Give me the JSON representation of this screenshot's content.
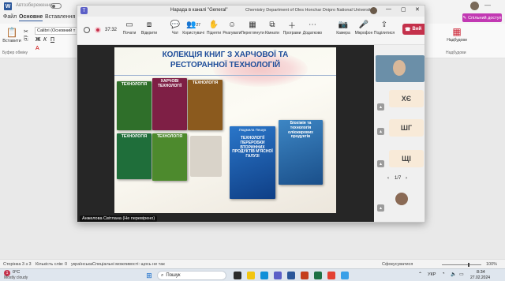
{
  "word": {
    "autosave_label": "Автозбереження",
    "tabs": [
      "Файл",
      "Основне",
      "Вставлення"
    ],
    "font_name": "Calibri (Основний т",
    "ribbon": {
      "paste_label": "Вставити",
      "clipboard_label": "Буфер обміну",
      "addins_label": "Надбудови",
      "addins_group_label": "Надбудови",
      "share_label": "Спільний доступ",
      "editor_hint": "Б"
    },
    "status": {
      "page": "Сторінка 3 з 3",
      "words": "Кількість слів: 0",
      "language": "українська",
      "accessibility": "Спеціальні можливості: щось не так",
      "focus": "Сфокусуватися",
      "zoom": "100%"
    }
  },
  "teams": {
    "title": "Нарада в каналі \"General\"",
    "org": "Chemistry Department of Oles Honchar Dnipro National University",
    "timer": "37:32",
    "toolbar": {
      "left": [
        "Почати",
        "Відкрити"
      ],
      "center": [
        {
          "label": "Чат",
          "icon": "chat-icon",
          "glyph": "💬"
        },
        {
          "label": "Користувачі",
          "icon": "people-icon",
          "glyph": "👥",
          "badge": "27"
        },
        {
          "label": "Підняти",
          "icon": "raise-hand-icon",
          "glyph": "✋"
        },
        {
          "label": "Реагувати",
          "icon": "react-icon",
          "glyph": "☺"
        },
        {
          "label": "Переглянути",
          "icon": "view-icon",
          "glyph": "▦"
        },
        {
          "label": "Кімнати",
          "icon": "rooms-icon",
          "glyph": "⧉"
        },
        {
          "label": "Програми",
          "icon": "apps-icon",
          "glyph": "＋"
        },
        {
          "label": "Додатково",
          "icon": "more-icon",
          "glyph": "⋯"
        }
      ],
      "right": [
        {
          "label": "Камера",
          "icon": "camera-icon",
          "glyph": "📷"
        },
        {
          "label": "Мікрофон",
          "icon": "mic-icon",
          "glyph": "🎤"
        },
        {
          "label": "Поділитися",
          "icon": "share-icon",
          "glyph": "⇪"
        }
      ],
      "leave_label": "Вий"
    },
    "slide": {
      "title_line1": "КОЛЕКЦІЯ КНИГ З ХАРЧОВОЇ ТА",
      "title_line2": "РЕСТОРАННОЇ ТЕХНОЛОГІЙ",
      "book1": "ТЕХНОЛОГІЯ",
      "book2": "ХАРЧОВІ ТЕХНОЛОГІЇ",
      "book3": "ТЕХНОЛОГІЯ",
      "book4": "ТЕХНОЛОГІЯ",
      "book5": "ТЕХНОЛОГІЯ",
      "book6_author": "Людмила Пешук",
      "book6_title": "ТЕХНОЛОГІЇ ПЕРЕРОБКИ ВТОРИННИХ ПРОДУКТІВ М'ЯСНОЇ ГАЛУЗІ",
      "book7": "Біохімія та технологія олієжирових продуктів"
    },
    "presenter": "Анжелова Світлана (Не перевірено)",
    "participants": [
      "ХЄ",
      "ШГ",
      "ЩІ"
    ],
    "pager": "1/7"
  },
  "taskbar": {
    "weather_temp": "0°C",
    "weather_desc": "Mostly cloudy",
    "search_placeholder": "Пошук",
    "lang": "УКР",
    "time": "8:34",
    "date": "27.02.2024"
  },
  "colors": {
    "teams_purple": "#5b5fc7",
    "leave_red": "#c4314b",
    "word_blue": "#2b579a",
    "share_pink": "#c239b3",
    "slide_title": "#1f4e9a"
  }
}
